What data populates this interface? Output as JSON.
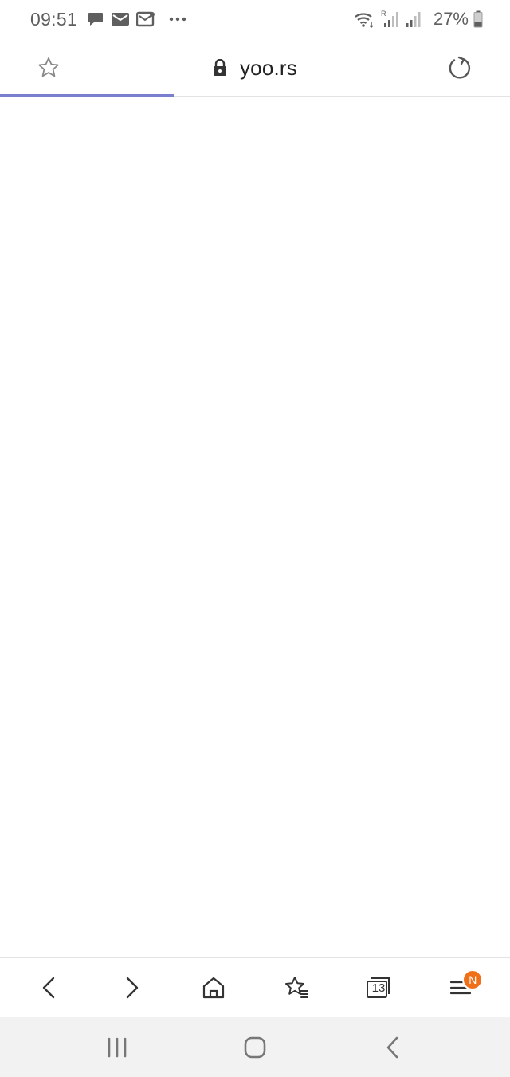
{
  "status_bar": {
    "time": "09:51",
    "battery_text": "27%",
    "icons": [
      "chat-icon",
      "mail-icon",
      "mail-open-icon",
      "more-dots-icon",
      "wifi-icon",
      "signal-roaming-icon",
      "signal-icon",
      "battery-icon"
    ]
  },
  "browser": {
    "url": "yoo.rs",
    "load_progress": 0.34,
    "colors": {
      "progress": "#7b7fd0",
      "badge": "#f0701a"
    }
  },
  "toolbar": {
    "tabs_count": "13",
    "menu_badge": "N"
  }
}
